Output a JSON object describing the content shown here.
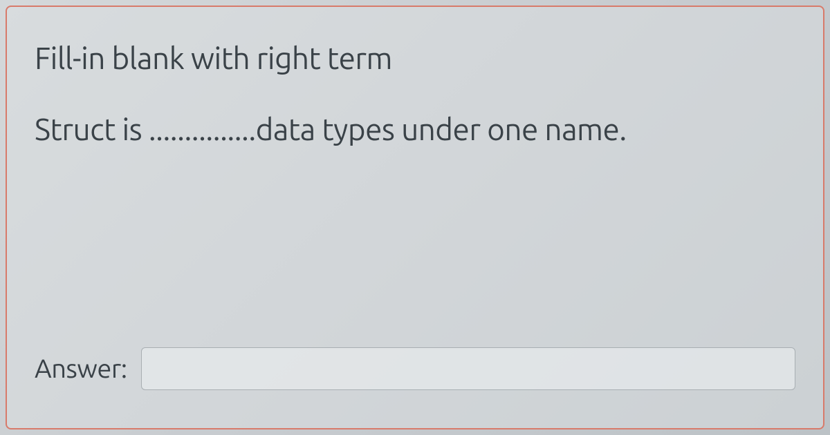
{
  "question": {
    "instruction": "Fill-in blank with right term",
    "prompt": "Struct is ...............data types under one name."
  },
  "answer": {
    "label": "Answer:",
    "value": ""
  }
}
